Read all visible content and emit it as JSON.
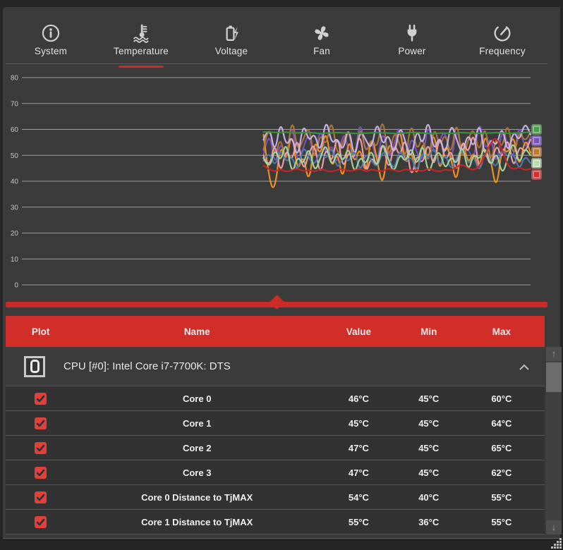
{
  "accent_color": "#d12d29",
  "tabs": {
    "active_index": 1,
    "items": [
      {
        "label": "System"
      },
      {
        "label": "Temperature"
      },
      {
        "label": "Voltage"
      },
      {
        "label": "Fan"
      },
      {
        "label": "Power"
      },
      {
        "label": "Frequency"
      }
    ]
  },
  "chart_data": {
    "type": "line",
    "title": "",
    "xlabel": "",
    "ylabel": "",
    "y_ticks": [
      80,
      70,
      60,
      50,
      40,
      30,
      20,
      10,
      0
    ],
    "ylim": [
      0,
      86
    ],
    "grid": true,
    "legend_position": "none",
    "x_data_start_frac": 0.475,
    "series": [
      {
        "name": "series-purple",
        "color": "#7b52c2",
        "values": [
          50,
          61,
          45,
          56,
          48,
          64,
          46,
          53,
          59,
          47,
          62,
          49,
          55,
          45,
          60,
          52,
          47,
          65,
          50,
          57,
          46,
          61,
          48,
          54,
          63,
          45,
          58,
          51,
          47,
          64,
          49,
          56,
          60,
          46,
          62,
          50,
          53,
          47,
          65,
          51,
          58,
          45,
          61,
          54,
          48,
          63,
          52,
          57
        ]
      },
      {
        "name": "series-orange",
        "color": "#f59422",
        "values": [
          58,
          40,
          36,
          55,
          47,
          60,
          43,
          51,
          38,
          57,
          49,
          61,
          44,
          52,
          39,
          58,
          46,
          54,
          41,
          59,
          48,
          37,
          56,
          50,
          62,
          45,
          53,
          40,
          57,
          47,
          61,
          42,
          55,
          49,
          38,
          58,
          46,
          52,
          43,
          60,
          48,
          36,
          54,
          50,
          59,
          44,
          57,
          51
        ]
      },
      {
        "name": "series-brown",
        "color": "#b0763a",
        "values": [
          52,
          64,
          48,
          58,
          45,
          66,
          51,
          56,
          62,
          47,
          59,
          53,
          65,
          49,
          55,
          61,
          46,
          63,
          50,
          57,
          52,
          66,
          47,
          60,
          54,
          48,
          64,
          51,
          58,
          45,
          62,
          53,
          59,
          49,
          65,
          47,
          56,
          61,
          50,
          63,
          46,
          58,
          52,
          64,
          48,
          60,
          55,
          59
        ]
      },
      {
        "name": "series-pink",
        "color": "#f2a0ac",
        "values": [
          50,
          44,
          56,
          42,
          53,
          47,
          58,
          43,
          51,
          55,
          41,
          54,
          46,
          59,
          44,
          52,
          48,
          60,
          42,
          50,
          45,
          57,
          43,
          55,
          49,
          58,
          40,
          51,
          46,
          56,
          44,
          59,
          47,
          53,
          42,
          57,
          50,
          60,
          43,
          52,
          45,
          55,
          48,
          58,
          44,
          54,
          51,
          56
        ]
      },
      {
        "name": "series-lavender",
        "color": "#c9b7e9",
        "values": [
          56,
          62,
          50,
          64,
          53,
          58,
          48,
          63,
          55,
          59,
          50,
          65,
          54,
          57,
          51,
          62,
          48,
          60,
          56,
          52,
          64,
          53,
          59,
          49,
          62,
          55,
          48,
          61,
          53,
          65,
          51,
          58,
          49,
          63,
          56,
          50,
          59,
          52,
          64,
          48,
          57,
          53,
          62,
          50,
          60,
          55,
          63,
          58
        ]
      },
      {
        "name": "series-blue",
        "color": "#4b7bb4",
        "values": [
          48,
          52,
          45,
          53,
          47,
          50,
          43,
          54,
          49,
          46,
          52,
          48,
          54,
          44,
          50,
          47,
          53,
          43,
          51,
          48,
          45,
          52,
          49,
          44,
          53,
          47,
          50,
          43,
          52,
          48,
          54,
          45,
          51,
          44,
          49,
          53,
          46,
          50,
          43,
          52,
          48,
          45,
          53,
          49,
          51,
          44,
          50,
          47
        ]
      },
      {
        "name": "series-lightgreen",
        "color": "#a8d89a",
        "values": [
          49,
          44,
          53,
          47,
          56,
          42,
          50,
          46,
          54,
          43,
          49,
          55,
          45,
          52,
          47,
          54,
          42,
          50,
          46,
          53,
          44,
          56,
          48,
          43,
          51,
          47,
          54,
          45,
          56,
          42,
          49,
          52,
          44,
          50,
          46,
          55,
          43,
          51,
          48,
          54,
          45,
          52,
          42,
          49,
          56,
          46,
          53,
          50
        ]
      },
      {
        "name": "series-green",
        "color": "#3f8f3f",
        "values": [
          59,
          59,
          58.8,
          58.8,
          59,
          58.6,
          58.6,
          58.8,
          58.8,
          58.6,
          58.4,
          58.6,
          58.6,
          58.8,
          58.6,
          58.6,
          58.4,
          58.4,
          58.6,
          58.6,
          58.8,
          58.6,
          58.6,
          58.4,
          58.6,
          58.6,
          58.8,
          58.8,
          58.6,
          58.4,
          58.4,
          58.6,
          58.6,
          58.4,
          58.6,
          58.8,
          58.6,
          58.6,
          58.4,
          58.6,
          58.6,
          58.8,
          58.6,
          58.4,
          58.6,
          58.6,
          58.8,
          59
        ]
      },
      {
        "name": "series-red",
        "color": "#cc2424",
        "values": [
          46,
          44.5,
          43.8,
          44.6,
          43.6,
          44.2,
          45,
          43.8,
          44.4,
          43.6,
          44.8,
          44,
          43.6,
          44.4,
          44.8,
          43.8,
          44.2,
          45,
          43.6,
          44.6,
          44,
          43.8,
          45,
          44.2,
          43.6,
          44.8,
          44,
          44.4,
          43.8,
          45,
          44.2,
          43.6,
          44.6,
          44,
          45.6,
          46.5,
          45,
          44.2,
          45.8,
          50,
          55,
          57,
          52,
          46,
          44.5,
          45.5,
          44.2,
          44.8
        ]
      }
    ],
    "endpoint_marker_colors": [
      "#4a9e4a",
      "#7b52c2",
      "#c0772e",
      "#b8dcaa",
      "#d32f2f"
    ]
  },
  "slider": {
    "position_pct": 50
  },
  "table": {
    "columns": [
      "Plot",
      "Name",
      "Value",
      "Min",
      "Max"
    ],
    "group_title": "CPU [#0]: Intel Core i7-7700K: DTS",
    "group_collapsed": false,
    "rows": [
      {
        "checked": true,
        "name": "Core 0",
        "value": "46°C",
        "min": "45°C",
        "max": "60°C"
      },
      {
        "checked": true,
        "name": "Core 1",
        "value": "45°C",
        "min": "45°C",
        "max": "64°C"
      },
      {
        "checked": true,
        "name": "Core 2",
        "value": "47°C",
        "min": "45°C",
        "max": "65°C"
      },
      {
        "checked": true,
        "name": "Core 3",
        "value": "47°C",
        "min": "45°C",
        "max": "62°C"
      },
      {
        "checked": true,
        "name": "Core 0 Distance to TjMAX",
        "value": "54°C",
        "min": "40°C",
        "max": "55°C"
      },
      {
        "checked": true,
        "name": "Core 1 Distance to TjMAX",
        "value": "55°C",
        "min": "36°C",
        "max": "55°C"
      }
    ]
  },
  "scrollbar": {
    "up_glyph": "↑",
    "down_glyph": "↓"
  }
}
